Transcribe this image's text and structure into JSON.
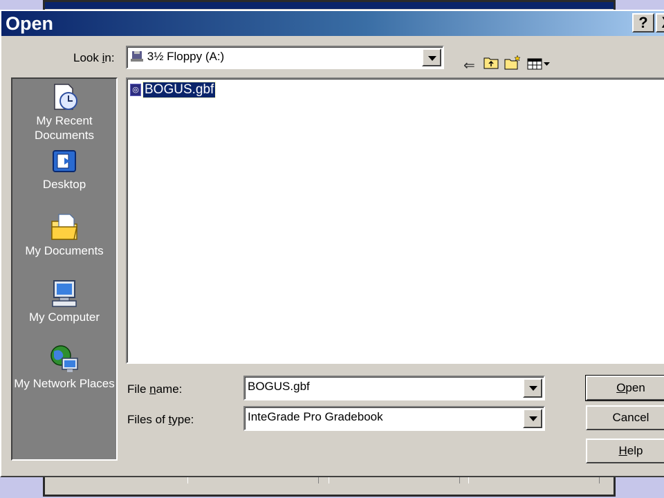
{
  "dialog": {
    "title": "Open",
    "help_button": "?",
    "close_button": "X"
  },
  "look_in": {
    "label": "Look in:",
    "underline_char": "i",
    "value": "3½ Floppy (A:)"
  },
  "toolbar": {
    "icons": [
      "back-icon",
      "up-folder-icon",
      "new-folder-icon",
      "views-menu-icon"
    ]
  },
  "places": {
    "items": [
      {
        "label": "My Recent Documents",
        "icon": "recent-documents-icon"
      },
      {
        "label": "Desktop",
        "icon": "desktop-icon"
      },
      {
        "label": "My Documents",
        "icon": "my-documents-icon"
      },
      {
        "label": "My Computer",
        "icon": "my-computer-icon"
      },
      {
        "label": "My Network Places",
        "icon": "network-places-icon"
      }
    ]
  },
  "files": [
    {
      "name": "BOGUS.gbf",
      "selected": true,
      "icon": "gradebook-file-icon"
    }
  ],
  "file_name": {
    "label_pre": "File ",
    "label_ul": "n",
    "label_post": "ame:",
    "value": "BOGUS.gbf"
  },
  "file_type": {
    "label_pre": "Files of ",
    "label_ul": "t",
    "label_post": "ype:",
    "value": "InteGrade Pro Gradebook"
  },
  "buttons": {
    "open_ul": "O",
    "open_rest": "pen",
    "cancel": "Cancel",
    "help_ul": "H",
    "help_rest": "elp"
  },
  "colors": {
    "titlebar_start": "#0a246a",
    "titlebar_end": "#a6caf0",
    "selection": "#0a246a",
    "face": "#d4d0c8"
  }
}
